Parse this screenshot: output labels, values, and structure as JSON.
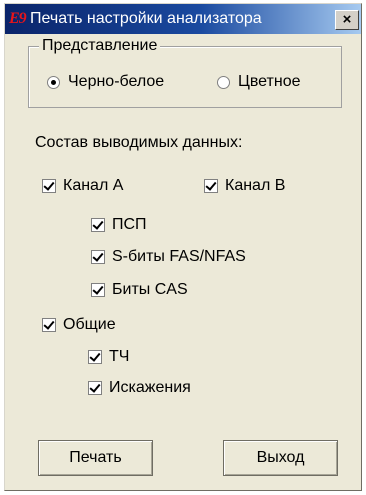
{
  "window": {
    "title": "Печать настройки анализатора",
    "app_icon_text": "E9",
    "close_glyph": "×"
  },
  "representation": {
    "legend": "Представление",
    "options": [
      {
        "label": "Черно-белое",
        "selected": true
      },
      {
        "label": "Цветное",
        "selected": false
      }
    ]
  },
  "output": {
    "heading": "Состав выводимых данных:",
    "channel_a": {
      "label": "Канал A",
      "checked": true
    },
    "channel_b": {
      "label": "Канал B",
      "checked": true
    },
    "psp": {
      "label": "ПСП",
      "checked": true
    },
    "sbits": {
      "label": "S-биты FAS/NFAS",
      "checked": true
    },
    "cas": {
      "label": "Биты CAS",
      "checked": true
    },
    "common": {
      "label": "Общие",
      "checked": true
    },
    "tch": {
      "label": "ТЧ",
      "checked": true
    },
    "distortion": {
      "label": "Искажения",
      "checked": true
    }
  },
  "buttons": {
    "print": "Печать",
    "exit": "Выход"
  }
}
